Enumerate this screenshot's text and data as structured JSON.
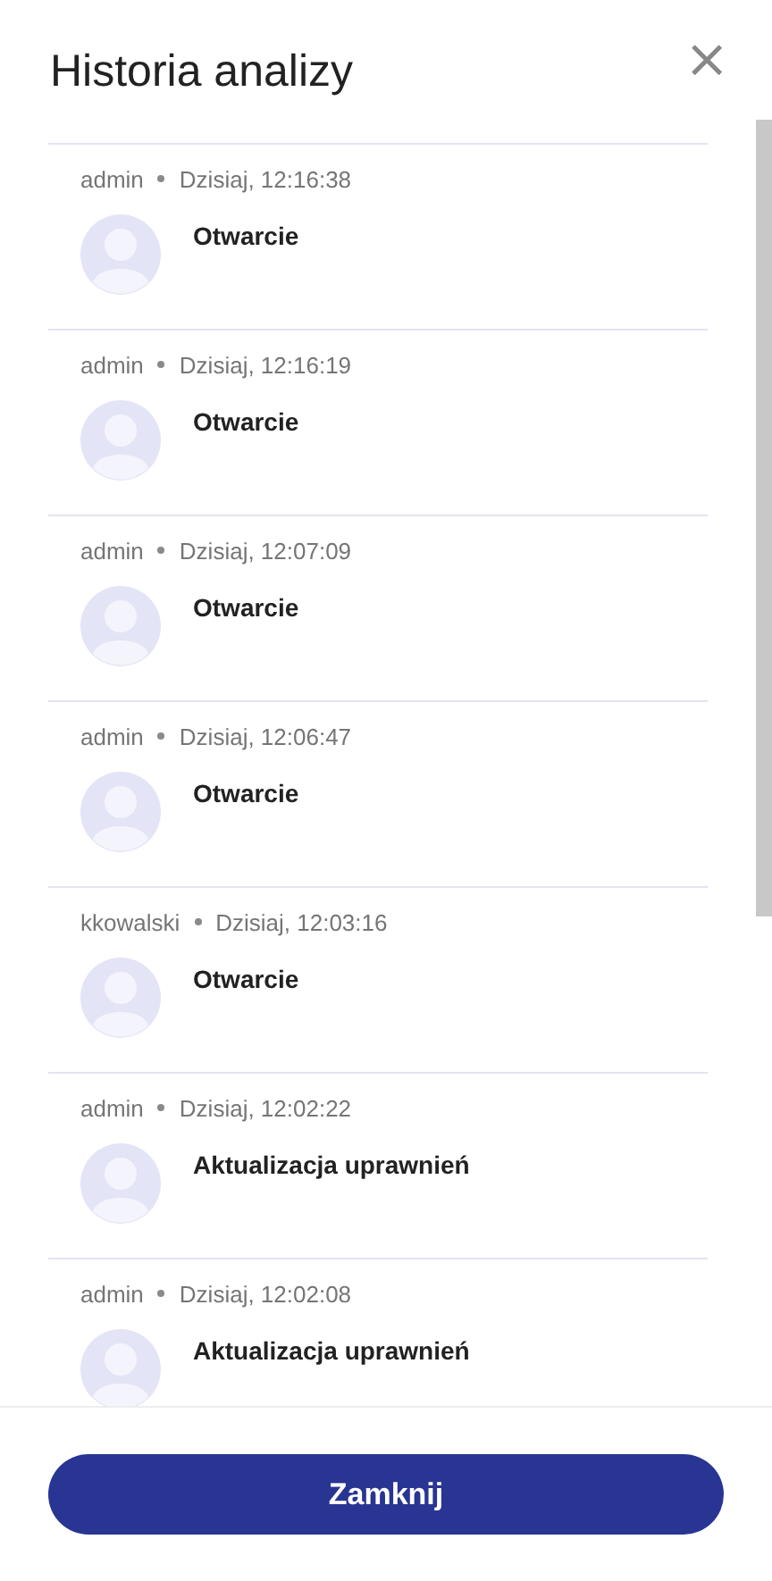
{
  "dialog": {
    "title": "Historia analizy",
    "close_icon": "×"
  },
  "entries": [
    {
      "user": "admin",
      "time": "Dzisiaj, 12:16:38",
      "action": "Otwarcie"
    },
    {
      "user": "admin",
      "time": "Dzisiaj, 12:16:19",
      "action": "Otwarcie"
    },
    {
      "user": "admin",
      "time": "Dzisiaj, 12:07:09",
      "action": "Otwarcie"
    },
    {
      "user": "admin",
      "time": "Dzisiaj, 12:06:47",
      "action": "Otwarcie"
    },
    {
      "user": "kkowalski",
      "time": "Dzisiaj, 12:03:16",
      "action": "Otwarcie"
    },
    {
      "user": "admin",
      "time": "Dzisiaj, 12:02:22",
      "action": "Aktualizacja uprawnień"
    },
    {
      "user": "admin",
      "time": "Dzisiaj, 12:02:08",
      "action": "Aktualizacja uprawnień"
    }
  ],
  "footer": {
    "button": "Zamknij"
  }
}
